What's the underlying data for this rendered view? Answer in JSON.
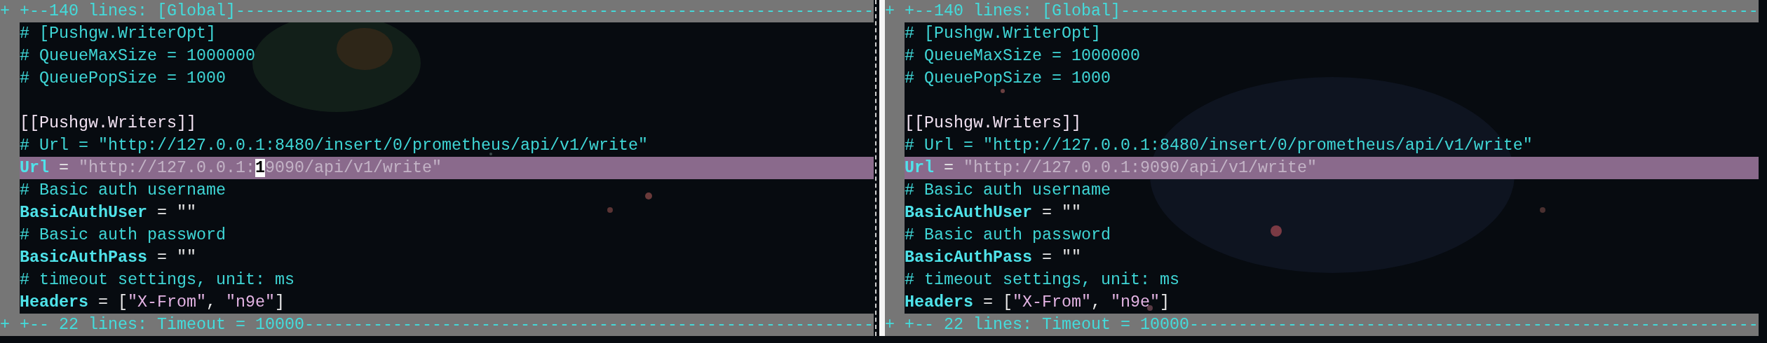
{
  "panes": [
    {
      "fold_top": {
        "sign": "+",
        "text": "+--140 lines: [Global]-----------------------------------------------------------------"
      },
      "lines": [
        {
          "kind": "normal",
          "segments": [
            {
              "text": "# [Pushgw.WriterOpt]",
              "kind": "comment"
            }
          ]
        },
        {
          "kind": "normal",
          "segments": [
            {
              "text": "# QueueMaxSize = 1000000",
              "kind": "comment"
            }
          ]
        },
        {
          "kind": "normal",
          "segments": [
            {
              "text": "# QueuePopSize = 1000",
              "kind": "comment"
            }
          ]
        },
        {
          "kind": "blank"
        },
        {
          "kind": "normal",
          "segments": [
            {
              "text": "[[Pushgw.Writers]]",
              "kind": "table"
            }
          ]
        },
        {
          "kind": "normal",
          "segments": [
            {
              "text": "# Url = \"http://127.0.0.1:8480/insert/0/prometheus/api/v1/write\"",
              "kind": "comment"
            }
          ]
        },
        {
          "kind": "changed",
          "segments": [
            {
              "text": "Url",
              "kind": "key"
            },
            {
              "text": " = ",
              "kind": "plain"
            },
            {
              "text": "\"http://127.0.0.1:",
              "kind": "dim"
            },
            {
              "text": "1",
              "kind": "dim",
              "cursor": true
            },
            {
              "text": "9090/api/v1/write\"",
              "kind": "dim"
            }
          ]
        },
        {
          "kind": "normal",
          "segments": [
            {
              "text": "# Basic auth username",
              "kind": "comment"
            }
          ]
        },
        {
          "kind": "normal",
          "segments": [
            {
              "text": "BasicAuthUser",
              "kind": "key"
            },
            {
              "text": " = \"\"",
              "kind": "plain"
            }
          ]
        },
        {
          "kind": "normal",
          "segments": [
            {
              "text": "# Basic auth password",
              "kind": "comment"
            }
          ]
        },
        {
          "kind": "normal",
          "segments": [
            {
              "text": "BasicAuthPass",
              "kind": "key"
            },
            {
              "text": " = \"\"",
              "kind": "plain"
            }
          ]
        },
        {
          "kind": "normal",
          "segments": [
            {
              "text": "# timeout settings, unit: ms",
              "kind": "comment"
            }
          ]
        },
        {
          "kind": "normal",
          "segments": [
            {
              "text": "Headers",
              "kind": "key"
            },
            {
              "text": " = [",
              "kind": "plain"
            },
            {
              "text": "\"X-From\"",
              "kind": "string"
            },
            {
              "text": ", ",
              "kind": "plain"
            },
            {
              "text": "\"n9e\"",
              "kind": "string"
            },
            {
              "text": "]",
              "kind": "plain"
            }
          ]
        }
      ],
      "fold_bottom": {
        "sign": "+",
        "text": "+-- 22 lines: Timeout = 10000----------------------------------------------------------"
      }
    },
    {
      "fold_top": {
        "sign": "+",
        "text": "+--140 lines: [Global]-----------------------------------------------------------------"
      },
      "lines": [
        {
          "kind": "normal",
          "segments": [
            {
              "text": "# [Pushgw.WriterOpt]",
              "kind": "comment"
            }
          ]
        },
        {
          "kind": "normal",
          "segments": [
            {
              "text": "# QueueMaxSize = 1000000",
              "kind": "comment"
            }
          ]
        },
        {
          "kind": "normal",
          "segments": [
            {
              "text": "# QueuePopSize = 1000",
              "kind": "comment"
            }
          ]
        },
        {
          "kind": "blank"
        },
        {
          "kind": "normal",
          "segments": [
            {
              "text": "[[Pushgw.Writers]]",
              "kind": "table"
            }
          ]
        },
        {
          "kind": "normal",
          "segments": [
            {
              "text": "# Url = \"http://127.0.0.1:8480/insert/0/prometheus/api/v1/write\"",
              "kind": "comment"
            }
          ]
        },
        {
          "kind": "changed",
          "segments": [
            {
              "text": "Url",
              "kind": "key"
            },
            {
              "text": " = ",
              "kind": "plain"
            },
            {
              "text": "\"http://127.0.0.1:9090/api/v1/write\"",
              "kind": "dim"
            }
          ]
        },
        {
          "kind": "normal",
          "segments": [
            {
              "text": "# Basic auth username",
              "kind": "comment"
            }
          ]
        },
        {
          "kind": "normal",
          "segments": [
            {
              "text": "BasicAuthUser",
              "kind": "key"
            },
            {
              "text": " = \"\"",
              "kind": "plain"
            }
          ]
        },
        {
          "kind": "normal",
          "segments": [
            {
              "text": "# Basic auth password",
              "kind": "comment"
            }
          ]
        },
        {
          "kind": "normal",
          "segments": [
            {
              "text": "BasicAuthPass",
              "kind": "key"
            },
            {
              "text": " = \"\"",
              "kind": "plain"
            }
          ]
        },
        {
          "kind": "normal",
          "segments": [
            {
              "text": "# timeout settings, unit: ms",
              "kind": "comment"
            }
          ]
        },
        {
          "kind": "normal",
          "segments": [
            {
              "text": "Headers",
              "kind": "key"
            },
            {
              "text": " = [",
              "kind": "plain"
            },
            {
              "text": "\"X-From\"",
              "kind": "string"
            },
            {
              "text": ", ",
              "kind": "plain"
            },
            {
              "text": "\"n9e\"",
              "kind": "string"
            },
            {
              "text": "]",
              "kind": "plain"
            }
          ]
        }
      ],
      "fold_bottom": {
        "sign": "+",
        "text": "+-- 22 lines: Timeout = 10000----------------------------------------------------------"
      }
    }
  ]
}
